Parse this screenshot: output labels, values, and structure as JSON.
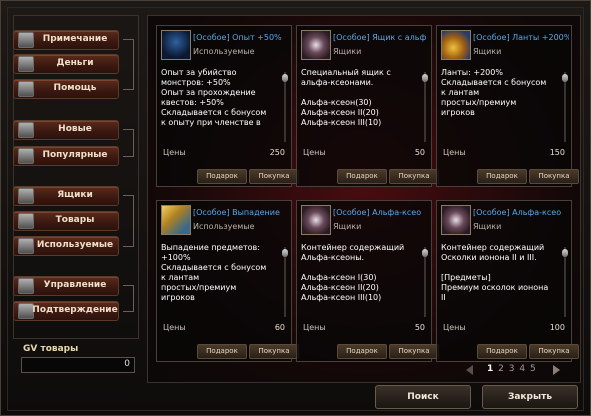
{
  "sidebar": {
    "groups": [
      [
        "Примечание",
        "Деньги",
        "Помощь"
      ],
      [
        "Новые",
        "Популярные"
      ],
      [
        "Ящики",
        "Товары",
        "Используемые"
      ],
      [
        "Управление",
        "Подтверждение"
      ]
    ]
  },
  "gv": {
    "label": "GV товары",
    "value": "0"
  },
  "cards": [
    {
      "title": "[Особое] Опыт +50%",
      "category": "Используемые",
      "desc": "Опыт за убийство\nмонстров: +50%\nОпыт за прохождение\nквестов: +50%\nСкладывается с бонусом\nк опыту при членстве в",
      "price_label": "Цены",
      "price": "250",
      "btn1": "Подарок",
      "btn2": "Покупка",
      "icon": "dark-knight-icon"
    },
    {
      "title": "[Особое] Ящик с альф",
      "category": "Ящики",
      "desc": "Специальный ящик с\nальфа-ксеонами.\n\nАльфа-ксеон(30)\nАльфа-ксеон II(20)\nАльфа-ксеон III(10)",
      "price_label": "Цены",
      "price": "50",
      "btn1": "Подарок",
      "btn2": "Покупка",
      "icon": "crate-icon"
    },
    {
      "title": "[Особое] Ланты +200%",
      "category": "Ящики",
      "desc": "Ланты: +200%\nСкладывается с бонусом\nк лантам\nпростых/премиум\nигроков",
      "price_label": "Цены",
      "price": "150",
      "btn1": "Подарок",
      "btn2": "Покупка",
      "icon": "coins-icon"
    },
    {
      "title": "[Особое] Выпадение",
      "category": "Используемые",
      "desc": "Выпадение предметов:\n+100%\nСкладывается с бонусом\nк лантам\nпростых/премиум\nигроков",
      "price_label": "Цены",
      "price": "60",
      "btn1": "Подарок",
      "btn2": "Покупка",
      "icon": "loot-icon"
    },
    {
      "title": "[Особое] Альфа-ксео",
      "category": "Ящики",
      "desc": "Контейнер содержащий\nАльфа-ксеоны.\n\nАльфа-ксеон I(30)\nАльфа-ксеон II(20)\nАльфа-ксеон III(10)",
      "price_label": "Цены",
      "price": "50",
      "btn1": "Подарок",
      "btn2": "Покупка",
      "icon": "crate-icon"
    },
    {
      "title": "[Особое] Альфа-ксео",
      "category": "Ящики",
      "desc": "Контейнер содержащий\nОсколки ионона II и III.\n\n[Предметы]\nПремиум осколок ионона\nII",
      "price_label": "Цены",
      "price": "100",
      "btn1": "Подарок",
      "btn2": "Покупка",
      "icon": "crate-icon"
    }
  ],
  "pagination": {
    "pages": [
      "1",
      "2",
      "3",
      "4",
      "5"
    ],
    "current": "1"
  },
  "buttons": {
    "search": "Поиск",
    "close": "Закрыть"
  }
}
